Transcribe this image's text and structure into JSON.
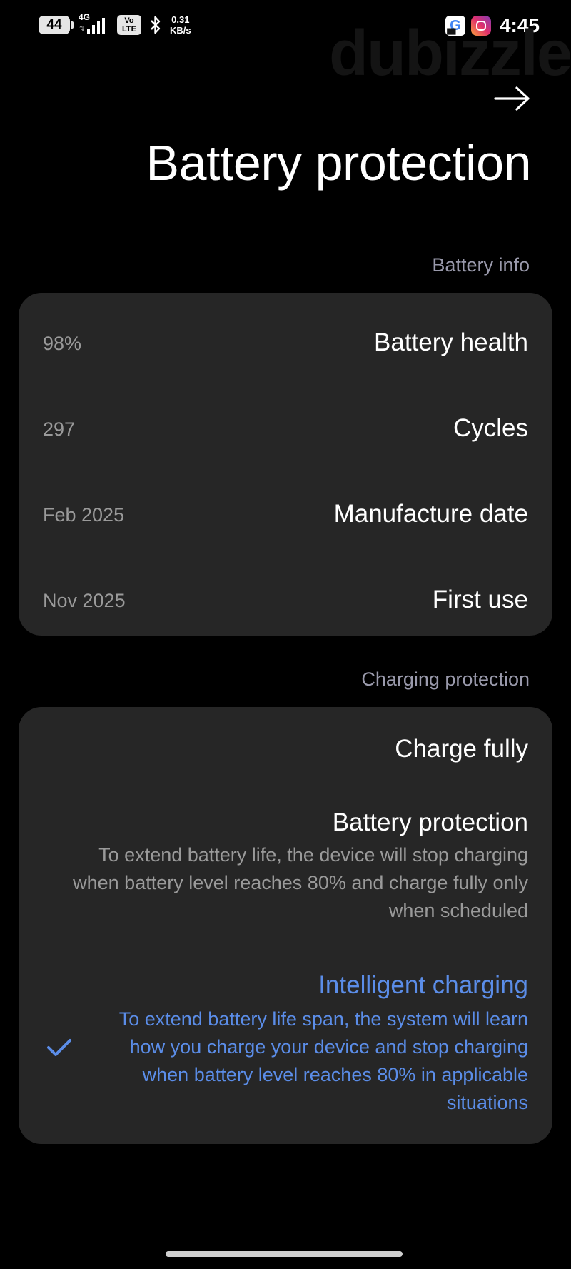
{
  "status_bar": {
    "battery_level": "44",
    "network_type": "4G",
    "volte": "Vo LTE",
    "data_speed_value": "0.31",
    "data_speed_unit": "KB/s",
    "app_icons": [
      "google-icon",
      "instagram-icon"
    ],
    "time": "4:45"
  },
  "watermark": "dubizzle",
  "header": {
    "title": "Battery protection",
    "nav_icon": "arrow-right-icon"
  },
  "battery_info": {
    "section_label": "Battery info",
    "rows": [
      {
        "value": "98%",
        "label": "Battery health"
      },
      {
        "value": "297",
        "label": "Cycles"
      },
      {
        "value": "Feb 2025",
        "label": "Manufacture date"
      },
      {
        "value": "Nov 2025",
        "label": "First use"
      }
    ]
  },
  "charging_protection": {
    "section_label": "Charging protection",
    "options": [
      {
        "title": "Charge fully",
        "description": "",
        "selected": false
      },
      {
        "title": "Battery protection",
        "description": "To extend battery life, the device will stop charging when battery level reaches 80% and charge fully only when scheduled",
        "selected": false
      },
      {
        "title": "Intelligent charging",
        "description": "To extend battery life span, the system will learn how you charge your device and stop charging when battery level reaches 80% in applicable situations",
        "selected": true
      }
    ]
  },
  "colors": {
    "background": "#000000",
    "card": "#262626",
    "accent": "#5b8de8",
    "secondary_text": "#9a9a9a"
  }
}
